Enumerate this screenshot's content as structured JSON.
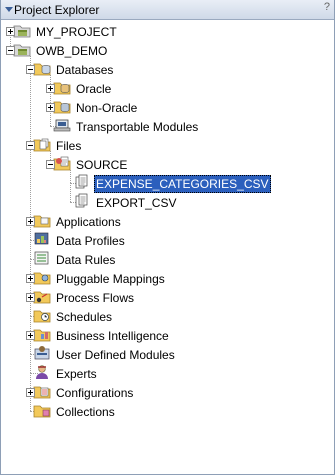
{
  "panel": {
    "title": "Project Explorer",
    "extra": "?"
  },
  "tree": [
    {
      "label": "MY_PROJECT",
      "icon": "project-icon",
      "level": 0,
      "expander": "plus"
    },
    {
      "label": "OWB_DEMO",
      "icon": "project-icon",
      "level": 0,
      "expander": "minus"
    },
    {
      "label": "Databases",
      "icon": "databases-folder-icon",
      "level": 1,
      "expander": "minus"
    },
    {
      "label": "Oracle",
      "icon": "oracle-database-icon",
      "level": 2,
      "expander": "plus"
    },
    {
      "label": "Non-Oracle",
      "icon": "non-oracle-database-icon",
      "level": 2,
      "expander": "plus"
    },
    {
      "label": "Transportable Modules",
      "icon": "transportable-modules-icon",
      "level": 2,
      "expander": "none"
    },
    {
      "label": "Files",
      "icon": "files-folder-icon",
      "level": 1,
      "expander": "minus"
    },
    {
      "label": "SOURCE",
      "icon": "source-module-icon",
      "level": 2,
      "expander": "minus"
    },
    {
      "label": "EXPENSE_CATEGORIES_CSV",
      "icon": "flat-file-icon",
      "level": 3,
      "expander": "none",
      "selected": true
    },
    {
      "label": "EXPORT_CSV",
      "icon": "flat-file-icon",
      "level": 3,
      "expander": "none"
    },
    {
      "label": "Applications",
      "icon": "applications-folder-icon",
      "level": 1,
      "expander": "plus"
    },
    {
      "label": "Data Profiles",
      "icon": "data-profiles-icon",
      "level": 1,
      "expander": "none"
    },
    {
      "label": "Data Rules",
      "icon": "data-rules-icon",
      "level": 1,
      "expander": "none"
    },
    {
      "label": "Pluggable Mappings",
      "icon": "pluggable-mappings-icon",
      "level": 1,
      "expander": "plus"
    },
    {
      "label": "Process Flows",
      "icon": "process-flows-icon",
      "level": 1,
      "expander": "plus"
    },
    {
      "label": "Schedules",
      "icon": "schedules-icon",
      "level": 1,
      "expander": "none"
    },
    {
      "label": "Business Intelligence",
      "icon": "business-intelligence-icon",
      "level": 1,
      "expander": "plus"
    },
    {
      "label": "User Defined Modules",
      "icon": "user-defined-modules-icon",
      "level": 1,
      "expander": "none"
    },
    {
      "label": "Experts",
      "icon": "experts-icon",
      "level": 1,
      "expander": "none"
    },
    {
      "label": "Configurations",
      "icon": "configurations-icon",
      "level": 1,
      "expander": "plus"
    },
    {
      "label": "Collections",
      "icon": "collections-icon",
      "level": 1,
      "expander": "none"
    }
  ],
  "colors": {
    "selection": "#2b5fbd",
    "folder": "#f2c95a",
    "header": "#cfd9e8"
  }
}
